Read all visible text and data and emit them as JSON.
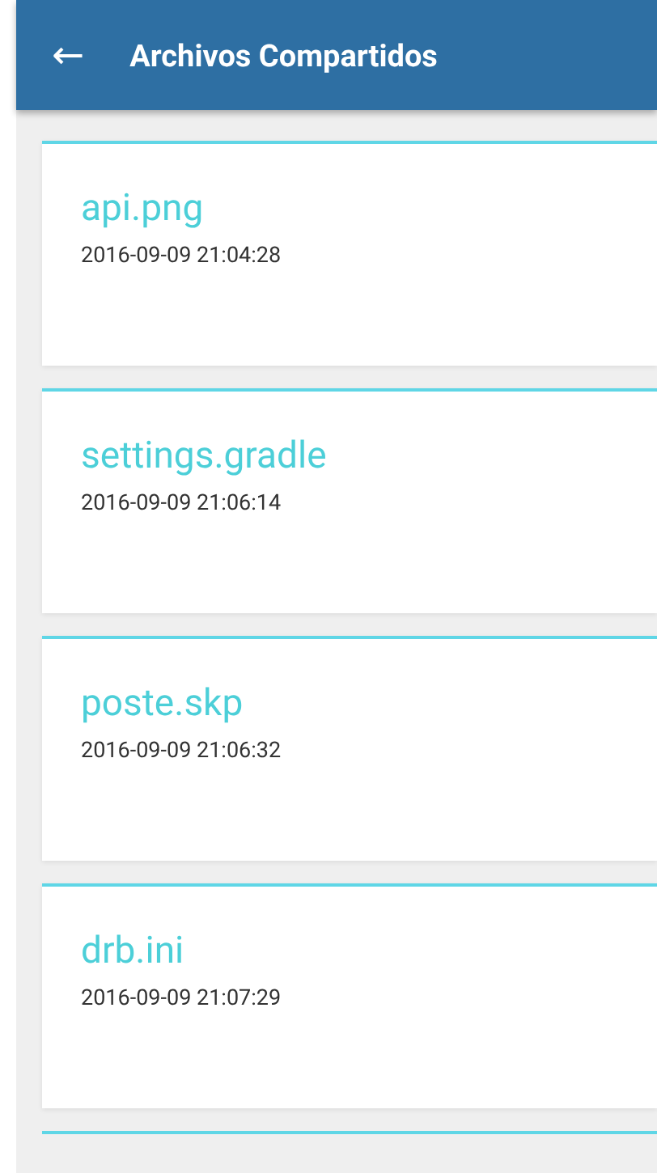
{
  "app_bar": {
    "back": "←",
    "title": "Archivos Compartidos"
  },
  "files": [
    {
      "name": "api.png",
      "date": "2016-09-09 21:04:28"
    },
    {
      "name": "settings.gradle",
      "date": "2016-09-09 21:06:14"
    },
    {
      "name": "poste.skp",
      "date": "2016-09-09 21:06:32"
    },
    {
      "name": "drb.ini",
      "date": "2016-09-09 21:07:29"
    }
  ]
}
